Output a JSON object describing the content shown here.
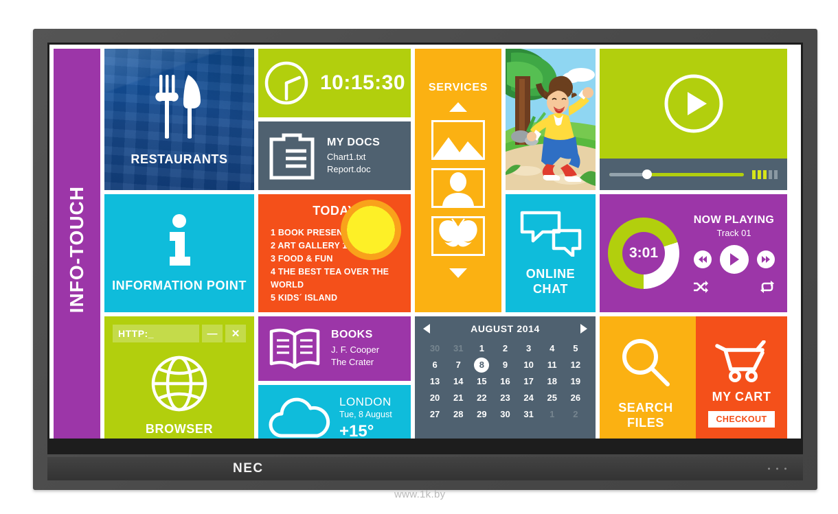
{
  "device": {
    "brand": "NEC",
    "watermark": "www.1k.by"
  },
  "sidebar": {
    "label": "INFO-TOUCH",
    "color": "#9c36a8"
  },
  "tiles": {
    "restaurants": {
      "caption": "RESTAURANTS",
      "icon": "fork-knife-icon",
      "color": "#0a53a8"
    },
    "information": {
      "caption": "INFORMATION POINT",
      "icon": "info-icon",
      "color": "#0fbcdb"
    },
    "browser": {
      "caption": "BROWSER",
      "url_value": "HTTP:_",
      "url_placeholder": "HTTP:_",
      "minimize_label": "—",
      "close_label": "✕",
      "icon": "globe-icon",
      "color": "#b2cf0d"
    },
    "clock": {
      "time": "10:15:30",
      "icon": "analog-clock-icon",
      "color": "#b2cf0d"
    },
    "docs": {
      "title": "MY DOCS",
      "files": [
        "Chart1.txt",
        "Report.doc"
      ],
      "icon": "clipboard-icon",
      "color": "#4f6170"
    },
    "today": {
      "title": "TODAY",
      "items": [
        "1 BOOK PRESENTATION",
        "2 ART GALLERY  1ST FLOOR",
        "3 FOOD & FUN",
        "4 THE BEST TEA OVER THE WORLD",
        "5 KIDS´ ISLAND"
      ],
      "color": "#f4501a",
      "sun_color": "#fdf027"
    },
    "books": {
      "title": "BOOKS",
      "author": "J. F. Cooper",
      "book": "The Crater",
      "icon": "open-book-icon",
      "color": "#9c36a8"
    },
    "weather": {
      "city": "LONDON",
      "date": "Tue, 8 August",
      "temperature": "+15°",
      "icon": "cloud-icon",
      "color": "#0fbcdb"
    },
    "services": {
      "title": "SERVICES",
      "up_label": "scroll-up",
      "down_label": "scroll-down",
      "thumbs": [
        "picture-icon",
        "person-icon",
        "butterfly-icon"
      ],
      "color": "#fbb112"
    },
    "kid_photo": {
      "alt": "boy-running-outdoors-illustration"
    },
    "chat": {
      "caption_line1": "ONLINE",
      "caption_line2": "CHAT",
      "icon": "speech-bubbles-icon",
      "color": "#0fbcdb"
    },
    "calendar": {
      "title": "AUGUST 2014",
      "prev_label": "previous-month",
      "next_label": "next-month",
      "selected_day": "8",
      "color": "#4f6170",
      "weeks": [
        [
          {
            "d": "30",
            "m": true
          },
          {
            "d": "31",
            "m": true
          },
          {
            "d": "1",
            "m": false
          },
          {
            "d": "2",
            "m": false
          },
          {
            "d": "3",
            "m": false
          },
          {
            "d": "4",
            "m": false
          },
          {
            "d": "5",
            "m": false
          }
        ],
        [
          {
            "d": "6",
            "m": false
          },
          {
            "d": "7",
            "m": false
          },
          {
            "d": "8",
            "m": false,
            "sel": true
          },
          {
            "d": "9",
            "m": false
          },
          {
            "d": "10",
            "m": false
          },
          {
            "d": "11",
            "m": false
          },
          {
            "d": "12",
            "m": false
          }
        ],
        [
          {
            "d": "13",
            "m": false
          },
          {
            "d": "14",
            "m": false
          },
          {
            "d": "15",
            "m": false
          },
          {
            "d": "16",
            "m": false
          },
          {
            "d": "17",
            "m": false
          },
          {
            "d": "18",
            "m": false
          },
          {
            "d": "19",
            "m": false
          }
        ],
        [
          {
            "d": "20",
            "m": false
          },
          {
            "d": "21",
            "m": false
          },
          {
            "d": "22",
            "m": false
          },
          {
            "d": "23",
            "m": false
          },
          {
            "d": "24",
            "m": false
          },
          {
            "d": "25",
            "m": false
          },
          {
            "d": "26",
            "m": false
          }
        ],
        [
          {
            "d": "27",
            "m": false
          },
          {
            "d": "28",
            "m": false
          },
          {
            "d": "29",
            "m": false
          },
          {
            "d": "30",
            "m": false
          },
          {
            "d": "31",
            "m": false
          },
          {
            "d": "1",
            "m": true
          },
          {
            "d": "2",
            "m": true
          }
        ]
      ]
    },
    "video": {
      "play_label": "play",
      "progress_percent": 28,
      "volume_on": 3,
      "volume_off": 2,
      "color": "#b2cf0d",
      "bar_color": "#4f6170"
    },
    "player": {
      "title": "NOW PLAYING",
      "track": "Track 01",
      "time": "3:01",
      "progress_degrees": 252,
      "prev_label": "previous-track",
      "play_label": "play",
      "next_label": "next-track",
      "shuffle_label": "shuffle",
      "repeat_label": "repeat",
      "color": "#9c36a8",
      "ring_color": "#b2cf0d"
    },
    "search": {
      "caption_line1": "SEARCH",
      "caption_line2": "FILES",
      "icon": "magnifier-icon",
      "color": "#fbb112"
    },
    "cart": {
      "caption": "MY CART",
      "checkout_label": "CHECKOUT",
      "icon": "shopping-cart-icon",
      "color": "#f4501a"
    }
  }
}
